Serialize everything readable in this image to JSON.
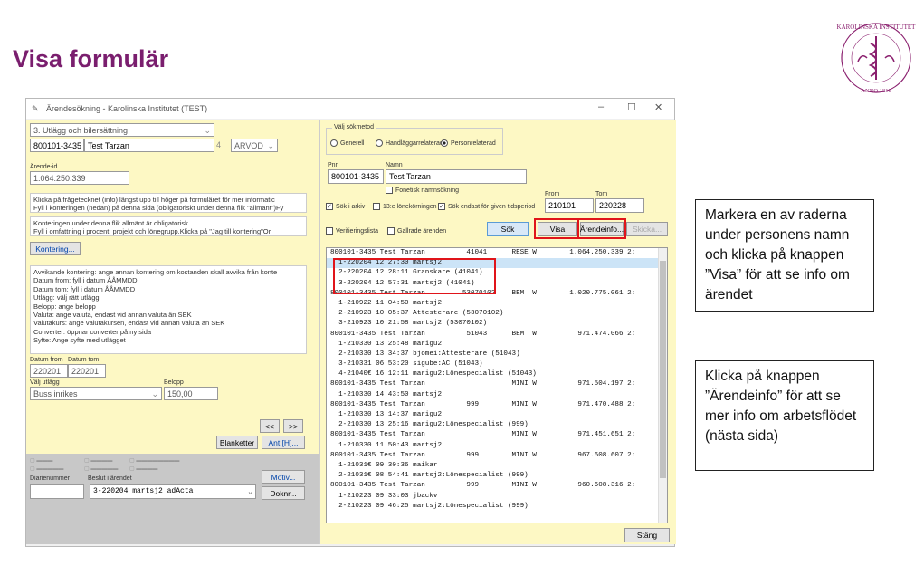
{
  "slide": {
    "title": "Visa formulär",
    "notes": [
      "Markera en av raderna under personens namn och klicka på knappen ”Visa” för att se info om ärendet",
      "Klicka på knappen ”Ärendeinfo” för att se mer info om arbetsflödet (nästa sida)"
    ],
    "logo_text": "KAROLINSKA INSTITUTET · ANNO 1810"
  },
  "window": {
    "title": "Ärendesökning  -  Karolinska Institutet (TEST)",
    "controls": [
      "–",
      "☐",
      "✕"
    ]
  },
  "left": {
    "category": "3. Utlägg och bilersättning",
    "pnr": "800101-3435",
    "name": "Test Tarzan",
    "code_num": "4",
    "code": "ARVOD",
    "arende_label": "Ärende-id",
    "arende_id": "1.064.250.339",
    "info1": [
      "Klicka på frågetecknet (info) längst upp till höger på formuläret för mer informatic",
      "Fyll i konteringen (nedan) på denna sida (obligatoriskt under denna flik \"allmänt\")Fy"
    ],
    "info2": [
      "Konteringen under denna flik allmänt är obligatorisk",
      "Fyll i omfattning i procent, projekt och lönegrupp.Klicka på \"Jag till kontering\"Or"
    ],
    "kontering_btn": "Kontering...",
    "info3": [
      "Avvikande kontering: ange annan kontering om kostanden skall avvika från konte",
      "Datum from: fyll i datum ÅÅMMDD",
      "Datum tom: fyll i datum ÅÅMMDD",
      "Utlägg: välj rätt utlägg",
      "Belopp: ange belopp",
      "Valuta: ange valuta, endast vid annan valuta än SEK",
      "Valutakurs: ange valutakursen, endast vid annan valuta än SEK",
      "Converter: öppnar converter på ny sida",
      "Syfte: Ange syfte med utlägget"
    ],
    "datum_from_label": "Datum from",
    "datum_tom_label": "Datum tom",
    "datum_from": "220201",
    "datum_tom": "220201",
    "utlagg_label": "Välj utlägg",
    "utlagg": "Buss inrikes",
    "belopp_label": "Belopp",
    "belopp": "150,00",
    "prev_btn": "<<",
    "next_btn": ">>",
    "blanketter_btn": "Blanketter",
    "ant_btn": "Ant [H]...",
    "diarie_label": "Diarienummer",
    "beslut_label": "Beslut i ärendet",
    "beslut": "3-220204 martsj2     adActa",
    "motiv_btn": "Motiv...",
    "doknr_btn": "Doknr..."
  },
  "right": {
    "sokmetod_label": "Välj sökmetod",
    "radio_generell": "Generell",
    "radio_handl": "Handläggarrelaterad",
    "radio_person": "Personrelaterad",
    "pnr_label": "Pnr",
    "namn_label": "Namn",
    "pnr": "800101-3435",
    "namn": "Test Tarzan",
    "fonetisk": "Fonetisk namnsökning",
    "from_label": "From",
    "tom_label": "Tom",
    "from": "210101",
    "tom": "220228",
    "sok_arkiv": "Sök i arkiv",
    "lonekorning": "13:e lönekörningen",
    "sok_endast": "Sök endast för given tidsperiod",
    "verif": "Verifieringslista",
    "gallrade": "Gallrade ärenden",
    "sok_btn": "Sök",
    "visa_btn": "Visa",
    "arendeinfo_btn": "Ärendeinfo...",
    "skicka_btn": "Skicka...",
    "stang_btn": "Stäng",
    "rows": [
      "800101-3435 Test Tarzan          41041      RESE W        1.064.250.339 2:",
      "  1-220204 12:27:30 martsj2",
      "  2-220204 12:28:11 Granskare (41041)",
      "  3-220204 12:57:31 martsj2 (41041)",
      "800101-3435 Test Tarzan         53070102    BEM  W        1.020.775.061 2:",
      "  1-210922 11:04:50 martsj2",
      "  2-210923 10:05:37 Attesterare (53070102)",
      "  3-210923 10:21:58 martsj2 (53070102)",
      "800101-3435 Test Tarzan          51043      BEM  W          971.474.066 2:",
      "  1-210330 13:25:48 marigu2",
      "  2-210330 13:34:37 bjomei:Attesterare (51043)",
      "  3-210331 06:53:20 sigube:AC (51043)",
      "  4-21040€ 16:12:11 marigu2:Lönespecialist (51043)",
      "800101-3435 Test Tarzan                     MINI W          971.504.197 2:",
      "  1-210330 14:43:50 martsj2",
      "800101-3435 Test Tarzan          999        MINI W          971.470.488 2:",
      "  1-210330 13:14:37 marigu2",
      "  2-210330 13:25:16 marigu2:Lönespecialist (999)",
      "800101-3435 Test Tarzan                     MINI W          971.451.651 2:",
      "  1-210330 11:50:43 martsj2",
      "800101-3435 Test Tarzan          999        MINI W          967.608.607 2:",
      "  1-21031€ 09:30:36 maikar",
      "  2-21031€ 08:54:41 martsj2:Lönespecialist (999)",
      "800101-3435 Test Tarzan          999        MINI W          960.608.316 2:",
      "  1-210223 09:33:03 jbackv",
      "  2-210223 09:46:25 martsj2:Lönespecialist (999)"
    ]
  }
}
